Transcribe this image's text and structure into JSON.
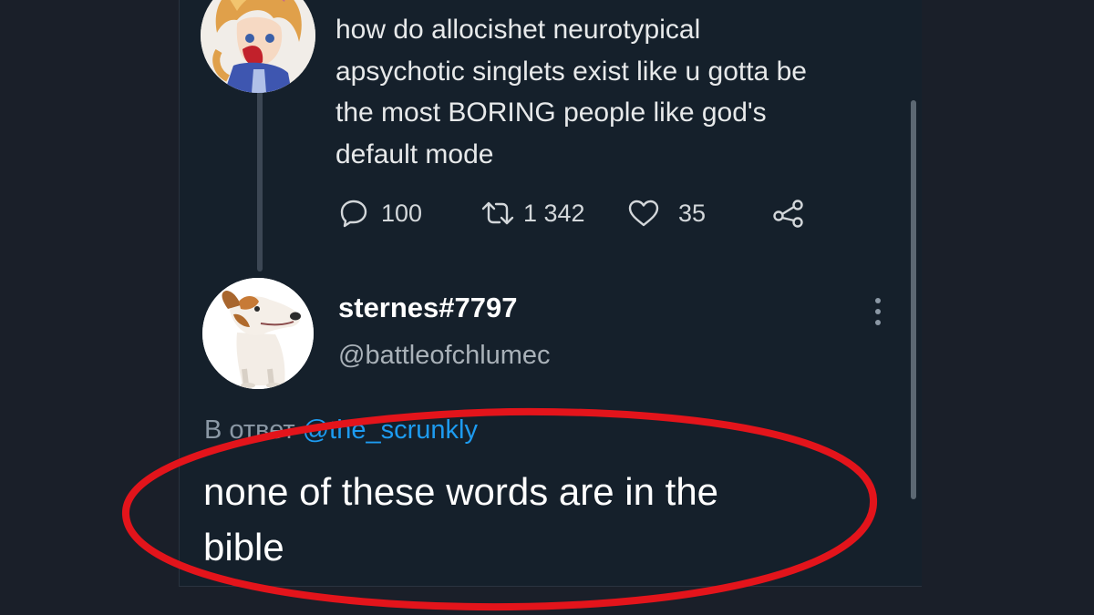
{
  "colors": {
    "background": "#15202b",
    "outer_background": "#1a1f29",
    "text": "#e7e9ea",
    "muted_text": "#8b98a5",
    "link": "#1d9bf0",
    "highlight_circle": "#e3141b"
  },
  "parent_tweet": {
    "avatar_icon": "anime-character-avatar-icon",
    "text_lines": [
      "how do allocishet neurotypical",
      "apsychotic singlets exist like u gotta be",
      "the most BORING people like god's",
      "default mode"
    ],
    "actions": {
      "reply_count": "100",
      "retweet_count": "1 342",
      "like_count": "35"
    }
  },
  "reply_tweet": {
    "avatar_icon": "dog-avatar-icon",
    "display_name": "sternes#7797",
    "handle": "@battleofchlumec",
    "reply_prefix": "В ответ",
    "reply_mention": "@the_scrunkly",
    "text_lines": [
      "none of these words are in the",
      "bible"
    ]
  }
}
